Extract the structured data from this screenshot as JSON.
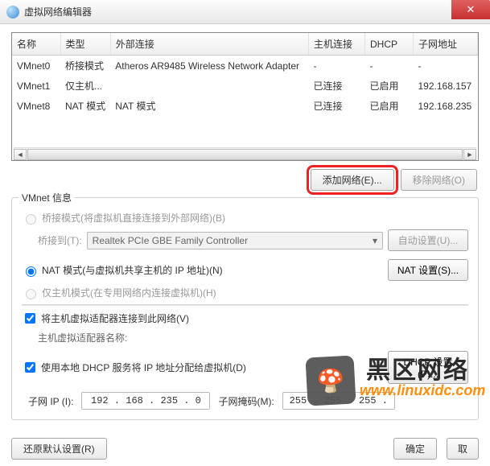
{
  "title": "虚拟网络编辑器",
  "table": {
    "headers": [
      "名称",
      "类型",
      "外部连接",
      "主机连接",
      "DHCP",
      "子网地址"
    ],
    "rows": [
      {
        "name": "VMnet0",
        "type": "桥接模式",
        "ext": "Atheros AR9485 Wireless Network Adapter",
        "host": "-",
        "dhcp": "-",
        "subnet": "-"
      },
      {
        "name": "VMnet1",
        "type": "仅主机...",
        "ext": "",
        "host": "已连接",
        "dhcp": "已启用",
        "subnet": "192.168.157"
      },
      {
        "name": "VMnet8",
        "type": "NAT 模式",
        "ext": "NAT 模式",
        "host": "已连接",
        "dhcp": "已启用",
        "subnet": "192.168.235"
      }
    ]
  },
  "buttons": {
    "add_network": "添加网络(E)...",
    "remove_network": "移除网络(O)",
    "restore": "还原默认设置(R)",
    "ok": "确定",
    "cancel": "取"
  },
  "group": {
    "title": "VMnet 信息",
    "radio_bridge": "桥接模式(将虚拟机直接连接到外部网络)(B)",
    "bridge_to_label": "桥接到(T):",
    "bridge_combo": "Realtek PCIe GBE Family Controller",
    "bridge_auto_btn": "自动设置(U)...",
    "radio_nat": "NAT 模式(与虚拟机共享主机的 IP 地址)(N)",
    "nat_btn": "NAT 设置(S)...",
    "radio_hostonly": "仅主机模式(在专用网络内连接虚拟机)(H)",
    "check_connect": "将主机虚拟适配器连接到此网络(V)",
    "adapter_name_label": "主机虚拟适配器名称:",
    "check_dhcp": "使用本地 DHCP 服务将 IP 地址分配给虚拟机(D)",
    "dhcp_btn": "DHCP 设置(P)...",
    "subnet_ip_label": "子网 IP (I):",
    "subnet_ip": "192 . 168 . 235 .  0",
    "subnet_mask_label": "子网掩码(M):",
    "subnet_mask": "255 . 255 . 255 ."
  },
  "watermark": {
    "big": "黑区网络",
    "url": "www.linuxidc.com",
    "icon": "🍄"
  }
}
